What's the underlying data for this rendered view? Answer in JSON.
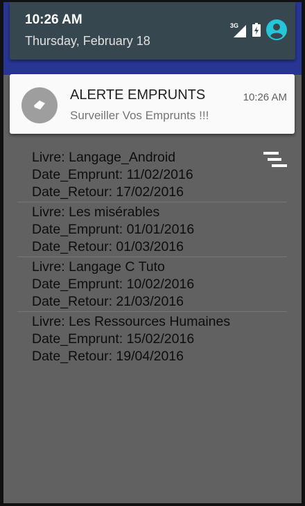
{
  "status_bar": {
    "time": "10:26 AM",
    "date": "Thursday, February 18",
    "network_label": "3G",
    "icons": [
      "signal-3g-icon",
      "battery-icon",
      "user-avatar-icon"
    ]
  },
  "notification": {
    "title": "ALERTE EMPRUNTS",
    "time": "10:26 AM",
    "text": "Surveiller Vos Emprunts !!!",
    "icon": "tag-icon"
  },
  "menu_icon": "overflow-menu-icon",
  "loans": [
    {
      "livre": "Livre: Langage_Android",
      "date_emprunt": "Date_Emprunt: 11/02/2016",
      "date_retour": "Date_Retour: 17/02/2016"
    },
    {
      "livre": "Livre: Les misérables",
      "date_emprunt": "Date_Emprunt: 01/01/2016",
      "date_retour": "Date_Retour: 01/03/2016"
    },
    {
      "livre": "Livre: Langage C Tuto",
      "date_emprunt": "Date_Emprunt: 10/02/2016",
      "date_retour": "Date_Retour: 21/03/2016"
    },
    {
      "livre": "Livre: Les Ressources Humaines",
      "date_emprunt": "Date_Emprunt: 15/02/2016",
      "date_retour": "Date_Retour: 19/04/2016"
    }
  ],
  "colors": {
    "shade_background": "#283592",
    "shade_panel": "#37474f",
    "avatar_accent": "#26c6da",
    "screen_background": "#616161"
  }
}
